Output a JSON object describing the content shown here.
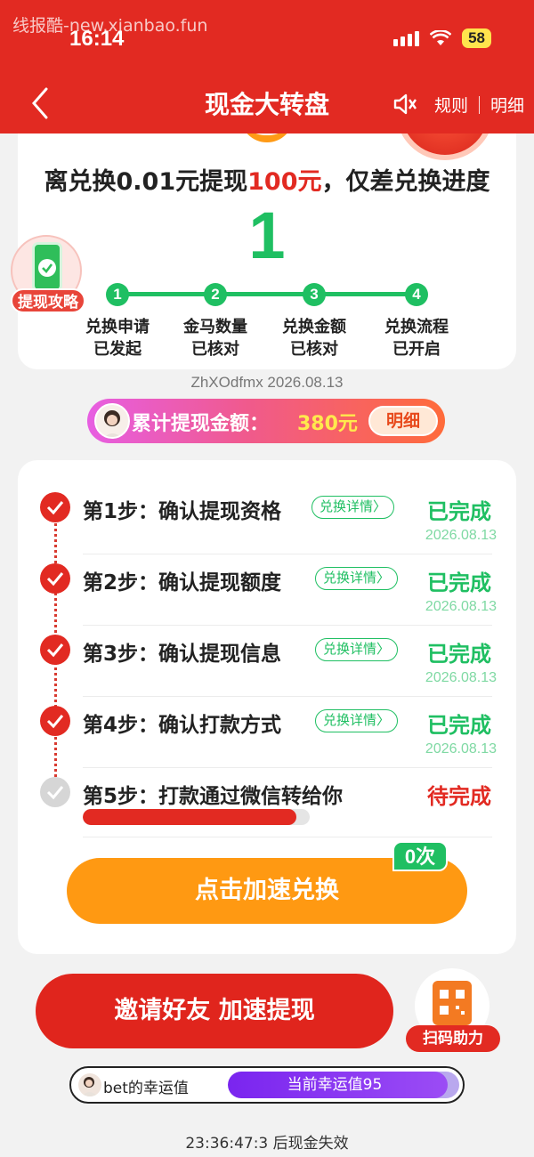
{
  "status_bar": {
    "watermark": "线报酷-new.xianbao.fun",
    "time": "16:14",
    "battery": "58"
  },
  "header": {
    "title": "现金大转盘",
    "rules": "规则",
    "details": "明细"
  },
  "summary": {
    "headline_pre": "离兑换0.01元提现",
    "headline_amount": "100元",
    "headline_post": "，仅差兑换进度",
    "remaining": "1",
    "milestones": [
      {
        "num": "1",
        "line1": "兑换申请",
        "line2": "已发起"
      },
      {
        "num": "2",
        "line1": "金马数量",
        "line2": "已核对"
      },
      {
        "num": "3",
        "line1": "兑换金额",
        "line2": "已核对"
      },
      {
        "num": "4",
        "line1": "兑换流程",
        "line2": "已开启"
      }
    ],
    "guide_label": "提现攻略"
  },
  "user_line": "ZhXOdfmx 2026.08.13",
  "total": {
    "label": "累计提现金额：",
    "amount": "380元",
    "detail": "明细"
  },
  "steps": [
    {
      "title": "第1步：确认提现资格",
      "detail": "兑换详情〉",
      "status": "已完成",
      "date": "2026.08.13",
      "done": true
    },
    {
      "title": "第2步：确认提现额度",
      "detail": "兑换详情〉",
      "status": "已完成",
      "date": "2026.08.13",
      "done": true
    },
    {
      "title": "第3步：确认提现信息",
      "detail": "兑换详情〉",
      "status": "已完成",
      "date": "2026.08.13",
      "done": true
    },
    {
      "title": "第4步：确认打款方式",
      "detail": "兑换详情〉",
      "status": "已完成",
      "date": "2026.08.13",
      "done": true
    },
    {
      "title": "第5步：打款通过微信转给你",
      "status": "待完成",
      "progress": 0.94,
      "done": false
    }
  ],
  "speed_button": {
    "label": "点击加速兑换",
    "count": "0次"
  },
  "invite_button": "邀请好友 加速提现",
  "scan_help": "扫码助力",
  "luck": {
    "label": "bet的幸运值",
    "meter_text": "当前幸运值95",
    "value": 95
  },
  "expire_text": "23:36:47:3 后现金失效",
  "colors": {
    "primary_red": "#e22a22",
    "success_green": "#1fbf62",
    "orange": "#ff9912",
    "purple": "#7a25ef"
  }
}
